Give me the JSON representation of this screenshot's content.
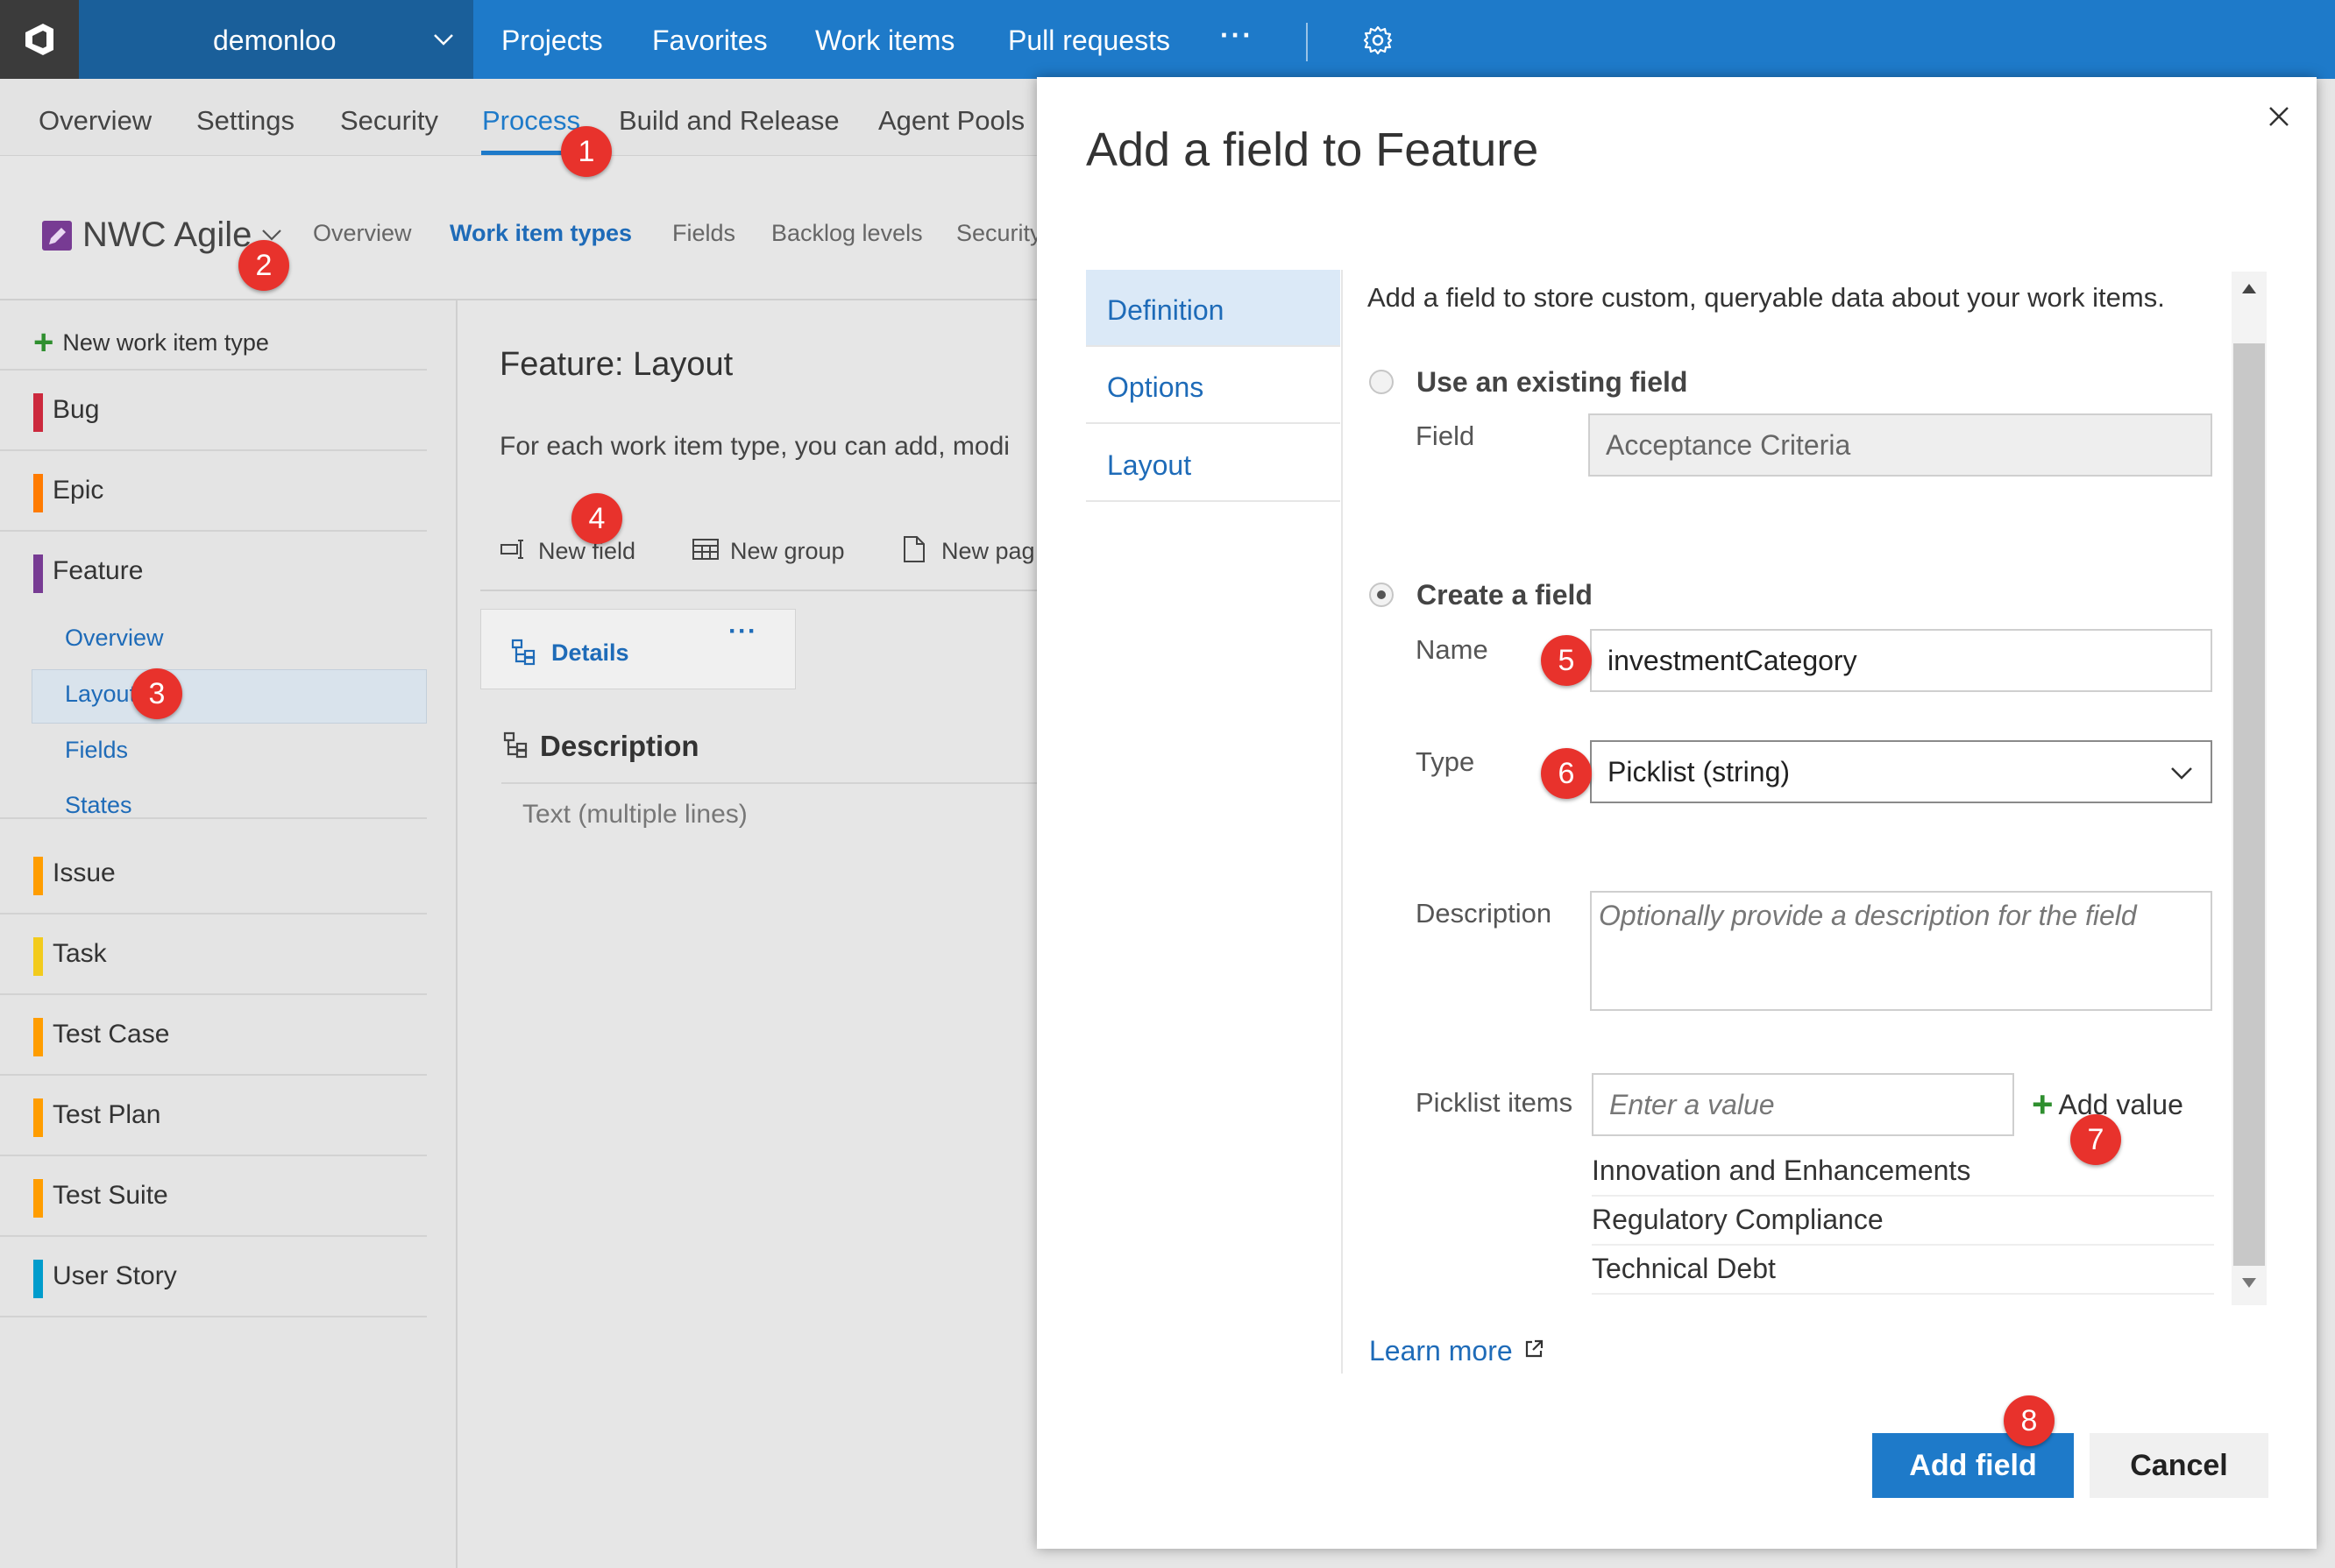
{
  "account": {
    "name": "demonloo"
  },
  "topnav": [
    "Projects",
    "Favorites",
    "Work items",
    "Pull requests"
  ],
  "subnav": [
    "Overview",
    "Settings",
    "Security",
    "Process",
    "Build and Release",
    "Agent Pools"
  ],
  "process": {
    "name": "NWC Agile",
    "tabs": [
      "Overview",
      "Work item types",
      "Fields",
      "Backlog levels",
      "Security"
    ]
  },
  "left": {
    "new_label": "New work item type",
    "types": [
      {
        "label": "Bug",
        "color": "#cc293d"
      },
      {
        "label": "Epic",
        "color": "#ff7b00"
      },
      {
        "label": "Feature",
        "color": "#773b93"
      },
      {
        "label": "Issue",
        "color": "#ff9d00"
      },
      {
        "label": "Task",
        "color": "#f2cb1d"
      },
      {
        "label": "Test Case",
        "color": "#ff9d00"
      },
      {
        "label": "Test Plan",
        "color": "#ff9d00"
      },
      {
        "label": "Test Suite",
        "color": "#ff9d00"
      },
      {
        "label": "User Story",
        "color": "#009ccc"
      }
    ],
    "feature_sub": [
      "Overview",
      "Layout",
      "Fields",
      "States"
    ]
  },
  "main": {
    "title": "Feature: Layout",
    "desc": "For each work item type, you can add, modi",
    "toolbar": [
      "New field",
      "New group",
      "New pag"
    ],
    "page_tab": "Details",
    "group_title": "Description",
    "group_field": "Text (multiple lines)"
  },
  "dialog": {
    "title": "Add a field to Feature",
    "tabs": [
      "Definition",
      "Options",
      "Layout"
    ],
    "intro": "Add a field to store custom, queryable data about your work items.",
    "existing_label": "Use an existing field",
    "field_label": "Field",
    "field_value": "Acceptance Criteria",
    "create_label": "Create a field",
    "name_label": "Name",
    "name_value": "investmentCategory",
    "type_label": "Type",
    "type_value": "Picklist (string)",
    "desc_label": "Description",
    "desc_placeholder": "Optionally provide a description for the field",
    "picklist_label": "Picklist items",
    "picklist_placeholder": "Enter a value",
    "add_value": "Add value",
    "picklist_items": [
      "Innovation and Enhancements",
      "Regulatory Compliance",
      "Technical Debt"
    ],
    "learn_more": "Learn more",
    "add_button": "Add field",
    "cancel_button": "Cancel"
  },
  "badges": [
    "1",
    "2",
    "3",
    "4",
    "5",
    "6",
    "7",
    "8"
  ]
}
